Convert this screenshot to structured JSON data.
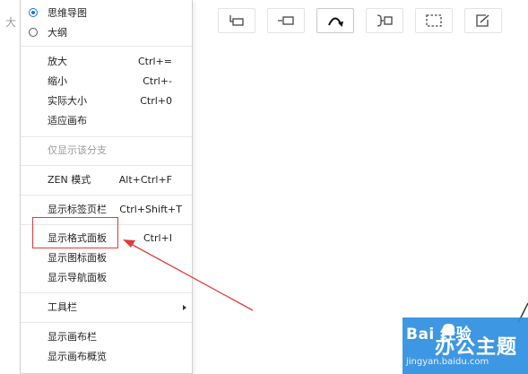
{
  "background": {
    "stub_text": "大"
  },
  "toolbar": {
    "buttons": [
      {
        "name": "child-topic-icon"
      },
      {
        "name": "sibling-topic-icon"
      },
      {
        "name": "relationship-icon"
      },
      {
        "name": "summary-icon"
      },
      {
        "name": "boundary-icon"
      },
      {
        "name": "note-icon"
      }
    ]
  },
  "menu": {
    "view_modes": [
      {
        "label": "思维导图",
        "selected": true
      },
      {
        "label": "大纲",
        "selected": false
      }
    ],
    "zoom": [
      {
        "label": "放大",
        "shortcut": "Ctrl+="
      },
      {
        "label": "缩小",
        "shortcut": "Ctrl+-"
      },
      {
        "label": "实际大小",
        "shortcut": "Ctrl+0"
      },
      {
        "label": "适应画布",
        "shortcut": ""
      }
    ],
    "branch_only": {
      "label": "仅显示该分支",
      "disabled": true
    },
    "zen": {
      "label": "ZEN 模式",
      "shortcut": "Alt+Ctrl+F"
    },
    "tabs_bar": {
      "label": "显示标签页栏",
      "shortcut": "Ctrl+Shift+T"
    },
    "panels": [
      {
        "label": "显示格式面板",
        "shortcut": "Ctrl+I"
      },
      {
        "label": "显示图标面板",
        "shortcut": ""
      },
      {
        "label": "显示导航面板",
        "shortcut": ""
      }
    ],
    "toolbar_item": {
      "label": "工具栏"
    },
    "canvas": [
      {
        "label": "显示画布栏"
      },
      {
        "label": "显示画布概览"
      }
    ]
  },
  "annotation": {
    "color": "#e23b3b"
  },
  "watermark": {
    "logo": "Bai  经验",
    "title": "办公主题",
    "url": "jingyan.baidu.com"
  },
  "colors": {
    "accent": "#1a73e8",
    "watermark_bg": "#2e8fe0"
  }
}
